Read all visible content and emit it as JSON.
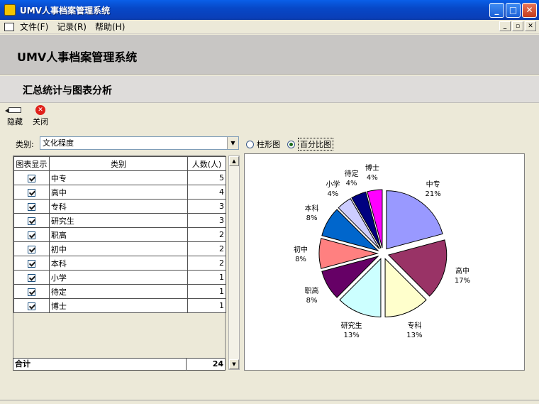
{
  "window": {
    "title": "UMV人事档案管理系统"
  },
  "menu": {
    "items": [
      "文件(F)",
      "记录(R)",
      "帮助(H)"
    ]
  },
  "header": {
    "title": "UMV人事档案管理系统",
    "section": "汇总统计与图表分析"
  },
  "toolbar": {
    "hide_label": "隐藏",
    "close_label": "关闭"
  },
  "filter": {
    "label": "类别:",
    "value": "文化程度"
  },
  "view": {
    "bar_label": "柱形图",
    "pie_label": "百分比图",
    "selected": "百分比图"
  },
  "table": {
    "columns": [
      "图表显示",
      "类别",
      "人数(人)"
    ],
    "rows": [
      {
        "category": "中专",
        "count": "5"
      },
      {
        "category": "高中",
        "count": "4"
      },
      {
        "category": "专科",
        "count": "3"
      },
      {
        "category": "研究生",
        "count": "3"
      },
      {
        "category": "职高",
        "count": "2"
      },
      {
        "category": "初中",
        "count": "2"
      },
      {
        "category": "本科",
        "count": "2"
      },
      {
        "category": "小学",
        "count": "1"
      },
      {
        "category": "待定",
        "count": "1"
      },
      {
        "category": "博士",
        "count": "1"
      }
    ],
    "total_label": "合计",
    "total_value": "24"
  },
  "chart_data": {
    "type": "pie",
    "slices": [
      {
        "label": "中专",
        "value": 5,
        "percent": "21%",
        "color": "#9999ff"
      },
      {
        "label": "高中",
        "value": 4,
        "percent": "17%",
        "color": "#993366"
      },
      {
        "label": "专科",
        "value": 3,
        "percent": "13%",
        "color": "#ffffcc"
      },
      {
        "label": "研究生",
        "value": 3,
        "percent": "13%",
        "color": "#ccffff"
      },
      {
        "label": "职高",
        "value": 2,
        "percent": "8%",
        "color": "#660066"
      },
      {
        "label": "初中",
        "value": 2,
        "percent": "8%",
        "color": "#ff8080"
      },
      {
        "label": "本科",
        "value": 2,
        "percent": "8%",
        "color": "#0066cc"
      },
      {
        "label": "小学",
        "value": 1,
        "percent": "4%",
        "color": "#ccccff"
      },
      {
        "label": "待定",
        "value": 1,
        "percent": "4%",
        "color": "#000080"
      },
      {
        "label": "博士",
        "value": 1,
        "percent": "4%",
        "color": "#ff00ff"
      }
    ]
  }
}
